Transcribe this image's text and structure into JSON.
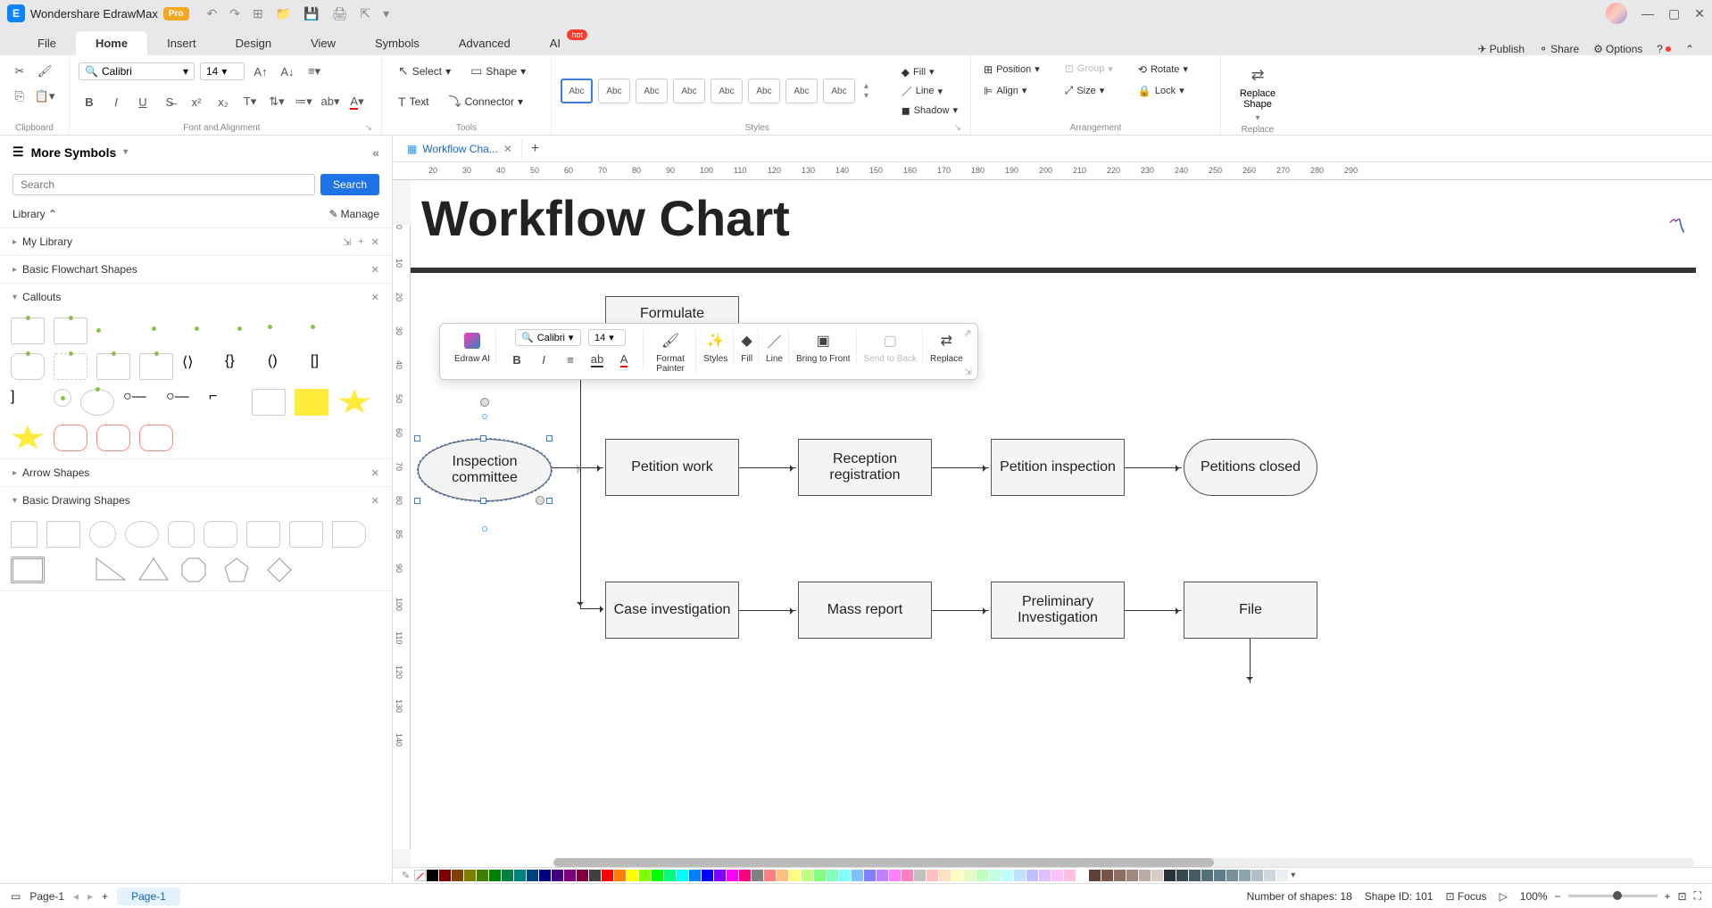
{
  "app": {
    "title": "Wondershare EdrawMax",
    "badge": "Pro"
  },
  "menubar": {
    "tabs": [
      "File",
      "Home",
      "Insert",
      "Design",
      "View",
      "Symbols",
      "Advanced",
      "AI"
    ],
    "active": "Home",
    "hot_badge": "hot",
    "right": {
      "publish": "Publish",
      "share": "Share",
      "options": "Options"
    }
  },
  "ribbon": {
    "clipboard_label": "Clipboard",
    "font": {
      "name": "Calibri",
      "size": "14"
    },
    "font_label": "Font and Alignment",
    "tools": {
      "select": "Select",
      "shape": "Shape",
      "text": "Text",
      "connector": "Connector",
      "label": "Tools"
    },
    "styles": {
      "sample": "Abc",
      "label": "Styles",
      "fill": "Fill",
      "line": "Line",
      "shadow": "Shadow"
    },
    "arrange": {
      "position": "Position",
      "align": "Align",
      "group": "Group",
      "size": "Size",
      "rotate": "Rotate",
      "lock": "Lock",
      "label": "Arrangement"
    },
    "replace": {
      "btn": "Replace\nShape",
      "label": "Replace"
    }
  },
  "sidebar": {
    "title": "More Symbols",
    "search_placeholder": "Search",
    "search_btn": "Search",
    "library": "Library",
    "manage": "Manage",
    "sections": {
      "my_library": "My Library",
      "basic_flowchart": "Basic Flowchart Shapes",
      "callouts": "Callouts",
      "arrow_shapes": "Arrow Shapes",
      "basic_drawing": "Basic Drawing Shapes"
    }
  },
  "doc_tab": {
    "name": "Workflow Cha...",
    "add": "+"
  },
  "ruler_ticks": [
    "20",
    "30",
    "40",
    "50",
    "60",
    "70",
    "80",
    "90",
    "100",
    "110",
    "120",
    "130",
    "140",
    "150",
    "160",
    "170",
    "180",
    "190",
    "200",
    "210",
    "220",
    "230",
    "240",
    "250",
    "260",
    "270",
    "280",
    "290"
  ],
  "ruler_v_ticks": [
    "0",
    "10",
    "20",
    "30",
    "40",
    "50",
    "60",
    "70",
    "80",
    "85",
    "90",
    "100",
    "110",
    "120",
    "130",
    "140"
  ],
  "canvas": {
    "title": "Workflow Chart",
    "nodes": {
      "formulate": "Formulate",
      "inspection": "Inspection committee",
      "petition_work": "Petition work",
      "reception": "Reception registration",
      "petition_inspection": "Petition inspection",
      "petitions_closed": "Petitions closed",
      "case_investigation": "Case investigation",
      "mass_report": "Mass report",
      "preliminary": "Preliminary Investigation",
      "file": "File"
    }
  },
  "float_toolbar": {
    "font": "Calibri",
    "size": "14",
    "edraw_ai": "Edraw AI",
    "format_painter": "Format Painter",
    "styles": "Styles",
    "fill": "Fill",
    "line": "Line",
    "bring_front": "Bring to Front",
    "send_back": "Send to Back",
    "replace": "Replace"
  },
  "statusbar": {
    "page_name": "Page-1",
    "page_tab": "Page-1",
    "shapes_count": "Number of shapes: 18",
    "shape_id": "Shape ID: 101",
    "focus": "Focus",
    "zoom": "100%"
  },
  "colors": [
    "#000000",
    "#7f0000",
    "#804000",
    "#808000",
    "#408000",
    "#008000",
    "#008040",
    "#008080",
    "#004080",
    "#000080",
    "#400080",
    "#800080",
    "#800040",
    "#404040",
    "#ff0000",
    "#ff8000",
    "#ffff00",
    "#80ff00",
    "#00ff00",
    "#00ff80",
    "#00ffff",
    "#0080ff",
    "#0000ff",
    "#8000ff",
    "#ff00ff",
    "#ff0080",
    "#808080",
    "#ff8080",
    "#ffc080",
    "#ffff80",
    "#c0ff80",
    "#80ff80",
    "#80ffc0",
    "#80ffff",
    "#80c0ff",
    "#8080ff",
    "#c080ff",
    "#ff80ff",
    "#ff80c0",
    "#c0c0c0",
    "#ffc0c0",
    "#ffe0c0",
    "#ffffc0",
    "#e0ffc0",
    "#c0ffc0",
    "#c0ffe0",
    "#c0ffff",
    "#c0e0ff",
    "#c0c0ff",
    "#e0c0ff",
    "#ffc0ff",
    "#ffc0e0",
    "#ffffff",
    "#5d4037",
    "#795548",
    "#8d6e63",
    "#a1887f",
    "#bcaaa4",
    "#d7ccc8",
    "#263238",
    "#37474f",
    "#455a64",
    "#546e7a",
    "#607d8b",
    "#78909c",
    "#90a4ae",
    "#b0bec5",
    "#cfd8dc",
    "#eceff1"
  ]
}
